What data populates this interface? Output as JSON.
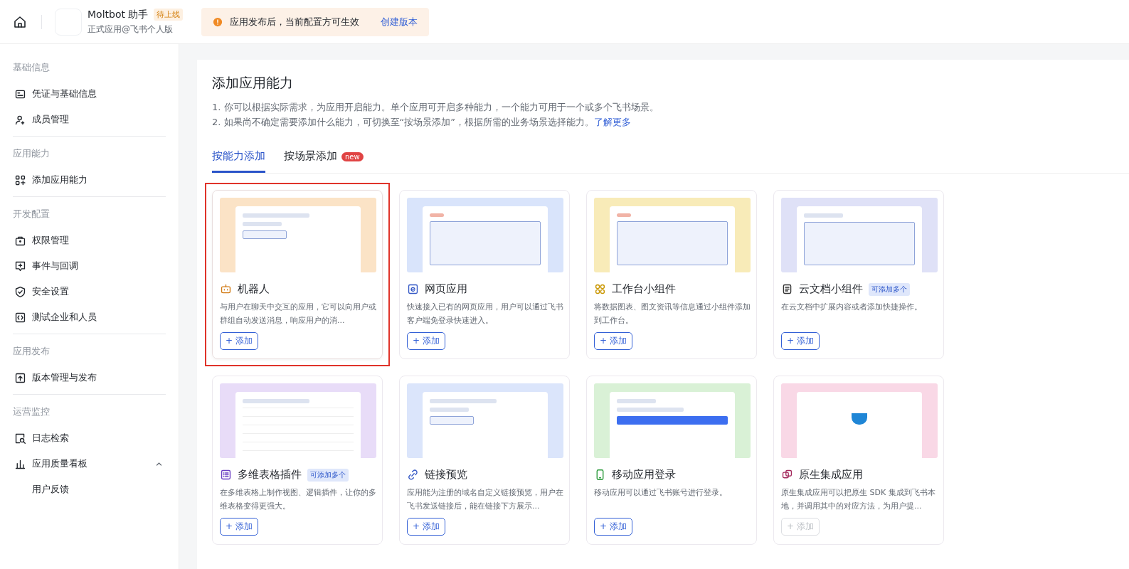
{
  "header": {
    "app_name": "Moltbot 助手",
    "status_badge": "待上线",
    "app_subtitle": "正式应用@飞书个人版",
    "notice": {
      "text": "应用发布后，当前配置方可生效",
      "link": "创建版本"
    }
  },
  "sidebar": {
    "groups": [
      {
        "title": "基础信息",
        "items": [
          {
            "label": "凭证与基础信息"
          },
          {
            "label": "成员管理"
          }
        ]
      },
      {
        "title": "应用能力",
        "items": [
          {
            "label": "添加应用能力"
          }
        ]
      },
      {
        "title": "开发配置",
        "items": [
          {
            "label": "权限管理"
          },
          {
            "label": "事件与回调"
          },
          {
            "label": "安全设置"
          },
          {
            "label": "测试企业和人员"
          }
        ]
      },
      {
        "title": "应用发布",
        "items": [
          {
            "label": "版本管理与发布"
          }
        ]
      },
      {
        "title": "运营监控",
        "items": [
          {
            "label": "日志检索"
          },
          {
            "label": "应用质量看板",
            "expanded": true,
            "children": [
              {
                "label": "用户反馈"
              }
            ]
          }
        ]
      }
    ]
  },
  "main": {
    "title": "添加应用能力",
    "notes": [
      "1. 你可以根据实际需求，为应用开启能力。单个应用可开启多种能力，一个能力可用于一个或多个飞书场景。",
      "2. 如果尚不确定需要添加什么能力，可切换至“按场景添加”，根据所需的业务场景选择能力。"
    ],
    "learn_more": "了解更多",
    "tabs": [
      {
        "label": "按能力添加",
        "selected": true
      },
      {
        "label": "按场景添加",
        "selected": false,
        "badge": "new"
      }
    ],
    "cards": [
      {
        "title": "机器人",
        "description": "与用户在聊天中交互的应用，它可以向用户或群组自动发送消息，响应用户的消...",
        "button": "+ 添加",
        "disabled": false,
        "highlighted": true
      },
      {
        "title": "网页应用",
        "description": "快速接入已有的网页应用，用户可以通过飞书客户端免登录快速进入。",
        "button": "+ 添加",
        "disabled": false,
        "highlighted": false
      },
      {
        "title": "工作台小组件",
        "description": "将数据图表、图文资讯等信息通过小组件添加到工作台。",
        "button": "+ 添加",
        "disabled": false,
        "highlighted": false
      },
      {
        "title": "云文档小组件",
        "badge": "可添加多个",
        "description": "在云文档中扩展内容或者添加快捷操作。",
        "button": "+ 添加",
        "disabled": false,
        "highlighted": false
      },
      {
        "title": "多维表格插件",
        "badge": "可添加多个",
        "description": "在多维表格上制作视图、逻辑插件，让你的多维表格变得更强大。",
        "button": "+ 添加",
        "disabled": false,
        "highlighted": false
      },
      {
        "title": "链接预览",
        "description": "应用能为注册的域名自定义链接预览，用户在飞书发送链接后，能在链接下方展示...",
        "button": "+ 添加",
        "disabled": false,
        "highlighted": false
      },
      {
        "title": "移动应用登录",
        "description": "移动应用可以通过飞书账号进行登录。",
        "button": "+ 添加",
        "disabled": false,
        "highlighted": false
      },
      {
        "title": "原生集成应用",
        "description": "原生集成应用可以把原生 SDK 集成到飞书本地，并调用其中的对应方法，为用户提...",
        "button": "+ 添加",
        "disabled": true,
        "highlighted": false
      }
    ]
  }
}
